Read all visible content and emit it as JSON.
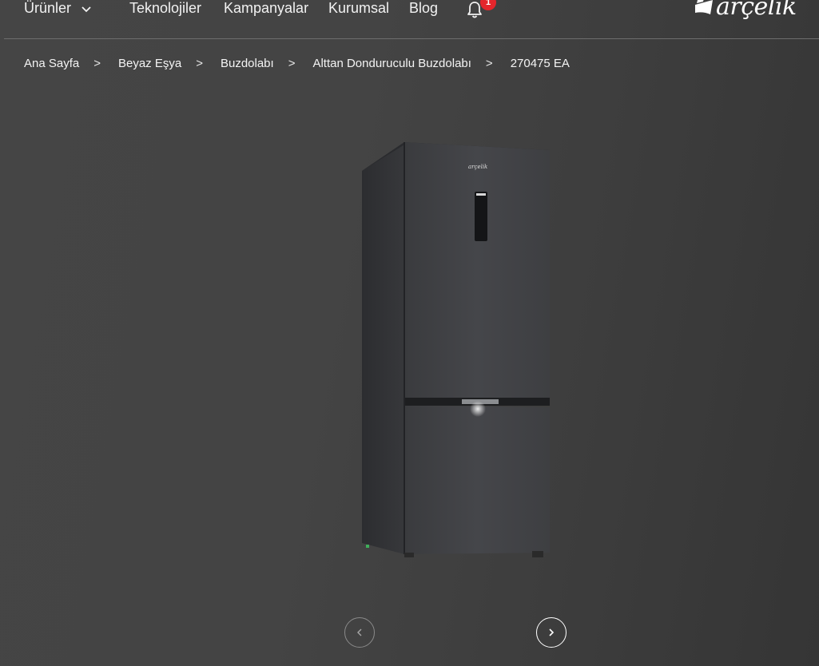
{
  "nav": {
    "products": "Ürünler",
    "technologies": "Teknolojiler",
    "campaigns": "Kampanyalar",
    "corporate": "Kurumsal",
    "blog": "Blog",
    "notification_count": "1",
    "brand": "arçelik"
  },
  "breadcrumb": {
    "items": [
      "Ana Sayfa",
      "Beyaz Eşya",
      "Buzdolabı",
      "Alttan Donduruculu Buzdolabı",
      "270475 EA"
    ],
    "separator": ">"
  },
  "product": {
    "image_alt": "270475 EA",
    "brand_mark": "arçelik"
  },
  "slider": {
    "prev_icon": "chevron-left-icon",
    "next_icon": "chevron-right-icon"
  },
  "colors": {
    "accent": "#e4262c",
    "background": "#404040",
    "text": "#ffffff"
  }
}
